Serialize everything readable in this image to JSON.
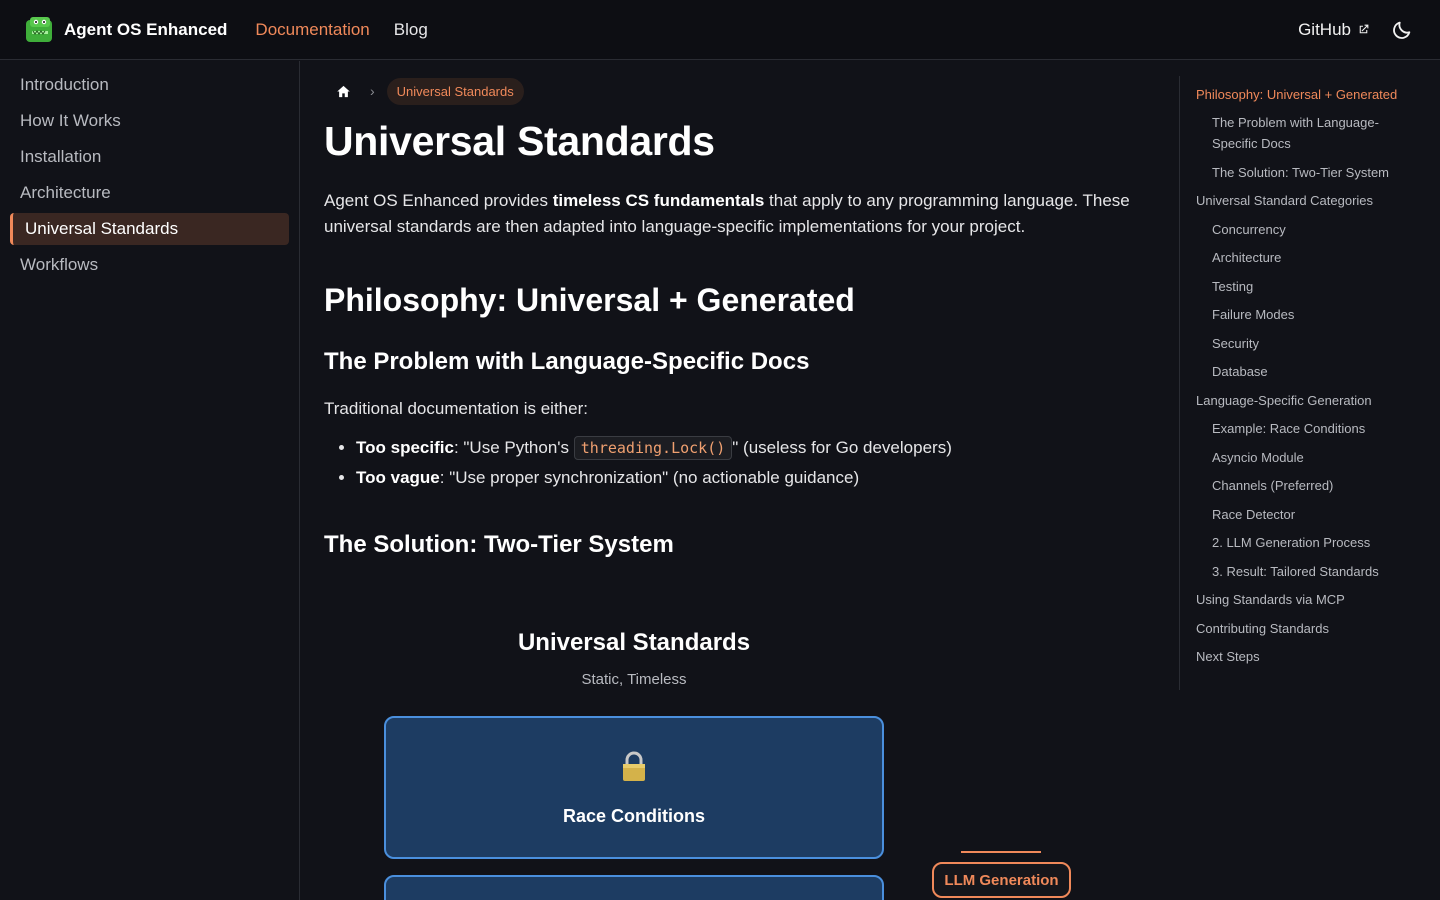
{
  "navbar": {
    "brand_title": "Agent OS Enhanced",
    "links": [
      "Documentation",
      "Blog"
    ],
    "github_label": "GitHub"
  },
  "sidebar": {
    "items": [
      "Introduction",
      "How It Works",
      "Installation",
      "Architecture",
      "Universal Standards",
      "Workflows"
    ],
    "active": "Universal Standards"
  },
  "breadcrumb": {
    "current": "Universal Standards"
  },
  "content": {
    "title": "Universal Standards",
    "lead_prefix": "Agent OS Enhanced provides ",
    "lead_bold": "timeless CS fundamentals",
    "lead_suffix": " that apply to any programming language. These universal standards are then adapted into language-specific implementations for your project.",
    "h2_philosophy": "Philosophy: Universal + Generated",
    "h3_problem": "The Problem with Language-Specific Docs",
    "problem_intro": "Traditional documentation is either:",
    "bullets": [
      {
        "bold": "Too specific",
        "pre": ": \"Use Python's ",
        "code": "threading.Lock()",
        "post": "\" (useless for Go developers)"
      },
      {
        "bold": "Too vague",
        "pre": ": \"Use proper synchronization\" (no actionable guidance)",
        "code": "",
        "post": ""
      }
    ],
    "h3_solution": "The Solution: Two-Tier System"
  },
  "diagram": {
    "title": "Universal Standards",
    "subtitle": "Static, Timeless",
    "card_label": "Race Conditions",
    "llm_label": "LLM Generation"
  },
  "toc": {
    "items": [
      {
        "label": "Philosophy: Universal + Generated",
        "level": 1,
        "active": true
      },
      {
        "label": "The Problem with Language-Specific Docs",
        "level": 2
      },
      {
        "label": "The Solution: Two-Tier System",
        "level": 2
      },
      {
        "label": "Universal Standard Categories",
        "level": 1
      },
      {
        "label": "Concurrency",
        "level": 2
      },
      {
        "label": "Architecture",
        "level": 2
      },
      {
        "label": "Testing",
        "level": 2
      },
      {
        "label": "Failure Modes",
        "level": 2
      },
      {
        "label": "Security",
        "level": 2
      },
      {
        "label": "Database",
        "level": 2
      },
      {
        "label": "Language-Specific Generation",
        "level": 1
      },
      {
        "label": "Example: Race Conditions",
        "level": 2
      },
      {
        "label": "Asyncio Module",
        "level": 2
      },
      {
        "label": "Channels (Preferred)",
        "level": 2
      },
      {
        "label": "Race Detector",
        "level": 2
      },
      {
        "label": "2. LLM Generation Process",
        "level": 2
      },
      {
        "label": "3. Result: Tailored Standards",
        "level": 2
      },
      {
        "label": "Using Standards via MCP",
        "level": 1
      },
      {
        "label": "Contributing Standards",
        "level": 1
      },
      {
        "label": "Next Steps",
        "level": 1
      }
    ]
  },
  "colors": {
    "accent": "#f0895a",
    "background": "#111218",
    "card_fill": "#1d3c62",
    "card_border": "#4a8fdd"
  }
}
